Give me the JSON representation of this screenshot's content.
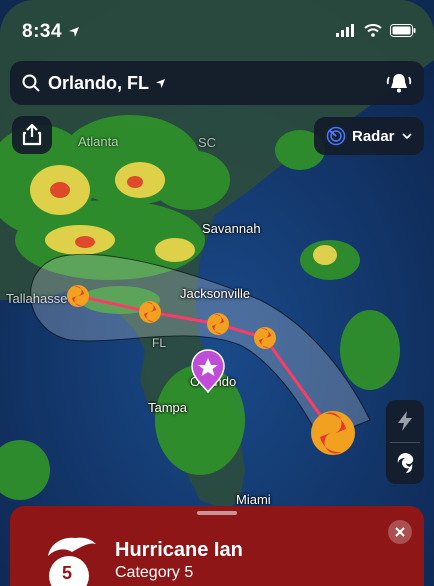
{
  "status_bar": {
    "time": "8:34"
  },
  "search": {
    "location": "Orlando, FL"
  },
  "layer_button": {
    "label": "Radar"
  },
  "map_labels": {
    "atlanta": "Atlanta",
    "sc": "SC",
    "savannah": "Savannah",
    "tallahassee": "Tallahassee",
    "jacksonville": "Jacksonville",
    "fl": "FL",
    "orlando": "Orlando",
    "tampa": "Tampa",
    "miami": "Miami"
  },
  "storm": {
    "name": "Hurricane Ian",
    "category_label": "Category 5",
    "category_number": "5"
  },
  "colors": {
    "sheet": "#8e1616",
    "track": "#ff3a66",
    "pin": "#c04dd8",
    "radar_green": "#2f8f2a",
    "radar_yellow": "#e8d84a"
  },
  "icons": [
    "location-arrow-icon",
    "search-icon",
    "signal-icon",
    "wifi-icon",
    "battery-icon",
    "bell-alert-icon",
    "share-icon",
    "radar-icon",
    "chevron-down-icon",
    "lightning-icon",
    "hurricane-icon",
    "close-icon",
    "favorite-star-icon"
  ]
}
